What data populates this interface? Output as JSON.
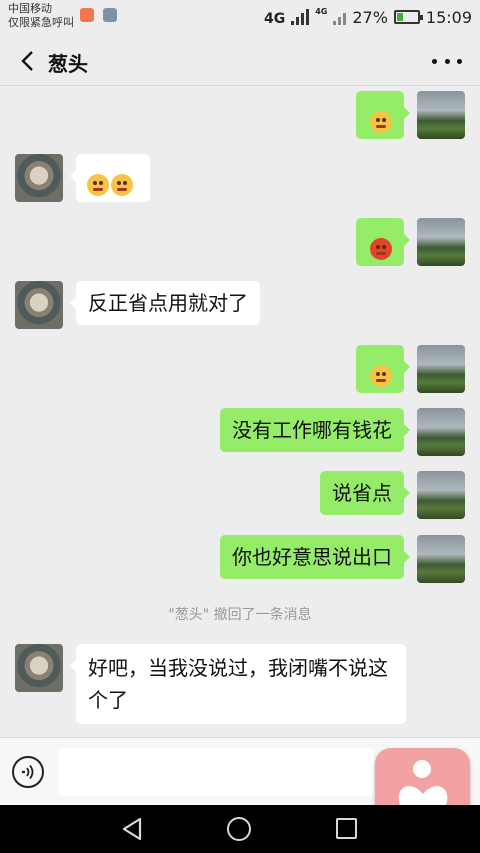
{
  "status_bar": {
    "carrier_line1": "中国移动",
    "carrier_line2": "仅限紧急呼叫",
    "network": "4G",
    "network2": "4G",
    "battery": "27%",
    "battery_level": 0.27,
    "time": "15:09"
  },
  "header": {
    "title": "葱头"
  },
  "messages": [
    {
      "side": "right",
      "type": "emoji",
      "emoji": "flushed-emoji"
    },
    {
      "side": "left",
      "type": "emoji",
      "emoji": "heart-eyes-emoji x2"
    },
    {
      "side": "right",
      "type": "emoji",
      "emoji": "angry-red-emoji"
    },
    {
      "side": "left",
      "type": "text",
      "text": "反正省点用就对了"
    },
    {
      "side": "right",
      "type": "emoji",
      "emoji": "smirk-emoji"
    },
    {
      "side": "right",
      "type": "text",
      "text": "没有工作哪有钱花"
    },
    {
      "side": "right",
      "type": "text",
      "text": "说省点"
    },
    {
      "side": "right",
      "type": "text",
      "text": "你也好意思说出口"
    },
    {
      "side": "system",
      "type": "system",
      "text": "\"葱头\" 撤回了一条消息"
    },
    {
      "side": "left",
      "type": "text",
      "text": "好吧，当我没说过，我闭嘴不说这个了"
    }
  ],
  "input": {
    "value": "",
    "placeholder": ""
  },
  "colors": {
    "sent_bubble": "#95ec69",
    "received_bubble": "#ffffff",
    "background": "#ededed",
    "float_button": "#f2a2a2"
  }
}
